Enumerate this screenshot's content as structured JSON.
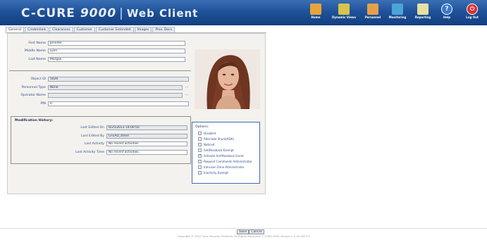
{
  "app": {
    "brand": "C-CURE",
    "version": "9000",
    "separator": "|",
    "subtitle": "Web Client"
  },
  "nav": [
    {
      "label": "Home",
      "icon": "home-icon",
      "color": "#e8a33b"
    },
    {
      "label": "Dynamic Views",
      "icon": "dynamic-views-icon",
      "color": "#d6c54a"
    },
    {
      "label": "Personnel",
      "icon": "personnel-icon",
      "color": "#e6a04a"
    },
    {
      "label": "Monitoring",
      "icon": "monitoring-icon",
      "color": "#4aa4d8"
    },
    {
      "label": "Reporting",
      "icon": "reporting-icon",
      "color": "#e8e0a0"
    },
    {
      "label": "Help",
      "icon": "help-icon",
      "color": "#3a78c8"
    },
    {
      "label": "Log Out",
      "icon": "logout-icon",
      "color": "#d83030"
    }
  ],
  "tabs": [
    "General",
    "Credentials",
    "Clearances",
    "Customer",
    "Customer Extended",
    "Images",
    "Prev. Docs"
  ],
  "person": {
    "first_name_label": "First Name",
    "first_name": "Jennifer",
    "middle_name_label": "Middle Name",
    "middle_name": "Lynn",
    "last_name_label": "Last Name",
    "last_name": "Morgan",
    "object_id_label": "Object ID",
    "object_id": "5026",
    "personnel_type_label": "Personnel Type",
    "personnel_type": "None",
    "operator_name_label": "Operator Name",
    "operator_name": "",
    "pin_label": "PIN",
    "pin": "0"
  },
  "modification": {
    "title": "Modification History:",
    "last_edited_on_label": "Last Edited On",
    "last_edited_on": "6/25/2013 14:00:50",
    "last_edited_by_label": "Last Edited By",
    "last_edited_by": "CFEAD_steve",
    "last_activity_label": "Last Activity",
    "last_activity": "No recent activities.",
    "last_activity_time_label": "Last Activity Time",
    "last_activity_time": "No recent activities."
  },
  "options": {
    "title": "Options:",
    "items": [
      {
        "label": "Disabled",
        "checked": false
      },
      {
        "label": "Alternate Shunt(ADA)",
        "checked": false
      },
      {
        "label": "Noticed",
        "checked": false
      },
      {
        "label": "AntiPassback Exempt",
        "checked": false
      },
      {
        "label": "Activate AntiPassback Event",
        "checked": true
      },
      {
        "label": "Request Commands Administrator",
        "checked": false
      },
      {
        "label": "Intrusion Zone Administrator",
        "checked": false
      },
      {
        "label": "Inactivity Exempt",
        "checked": false
      }
    ]
  },
  "footer": {
    "save": "Save",
    "cancel": "Cancel",
    "copyright": "Copyright © 2013 Tyco Security Products. All Rights Reserved. C-CURE 9000 Version v 2.20.4023.0"
  }
}
